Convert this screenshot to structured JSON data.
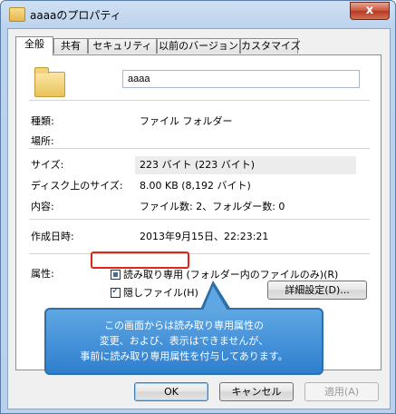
{
  "window": {
    "title": "aaaaのプロパティ",
    "close_label": "x"
  },
  "tabs": [
    {
      "label": "全般",
      "active": true
    },
    {
      "label": "共有",
      "active": false
    },
    {
      "label": "セキュリティ",
      "active": false
    },
    {
      "label": "以前のバージョン",
      "active": false
    },
    {
      "label": "カスタマイズ",
      "active": false
    }
  ],
  "general": {
    "folder_name": "aaaa",
    "type_label": "種類:",
    "type_value": "ファイル フォルダー",
    "location_label": "場所:",
    "location_value": "",
    "size_label": "サイズ:",
    "size_value": "223 バイト (223 バイト)",
    "disk_size_label": "ディスク上のサイズ:",
    "disk_size_value": "8.00 KB (8,192 バイト)",
    "contents_label": "内容:",
    "contents_value": "ファイル数: 2、フォルダー数: 0",
    "created_label": "作成日時:",
    "created_value": "2013年9月15日、22:23:21",
    "attributes_label": "属性:",
    "readonly_label": "読み取り専用 (フォルダー内のファイルのみ)(R)",
    "hidden_label": "隠しファイル(H)",
    "advanced_label": "詳細設定(D)..."
  },
  "callout": {
    "line1": "この画面からは読み取り専用属性の",
    "line2": "変更、および、表示はできませんが、",
    "line3": "事前に読み取り専用属性を付与してあります。"
  },
  "footer": {
    "ok_label": "OK",
    "cancel_label": "キャンセル",
    "apply_label": "適用(A)"
  },
  "colors": {
    "highlight": "#e2231a",
    "callout_fill": "#3f8fd8"
  },
  "icons": {
    "title": "folder-icon",
    "folder": "folder-icon"
  }
}
